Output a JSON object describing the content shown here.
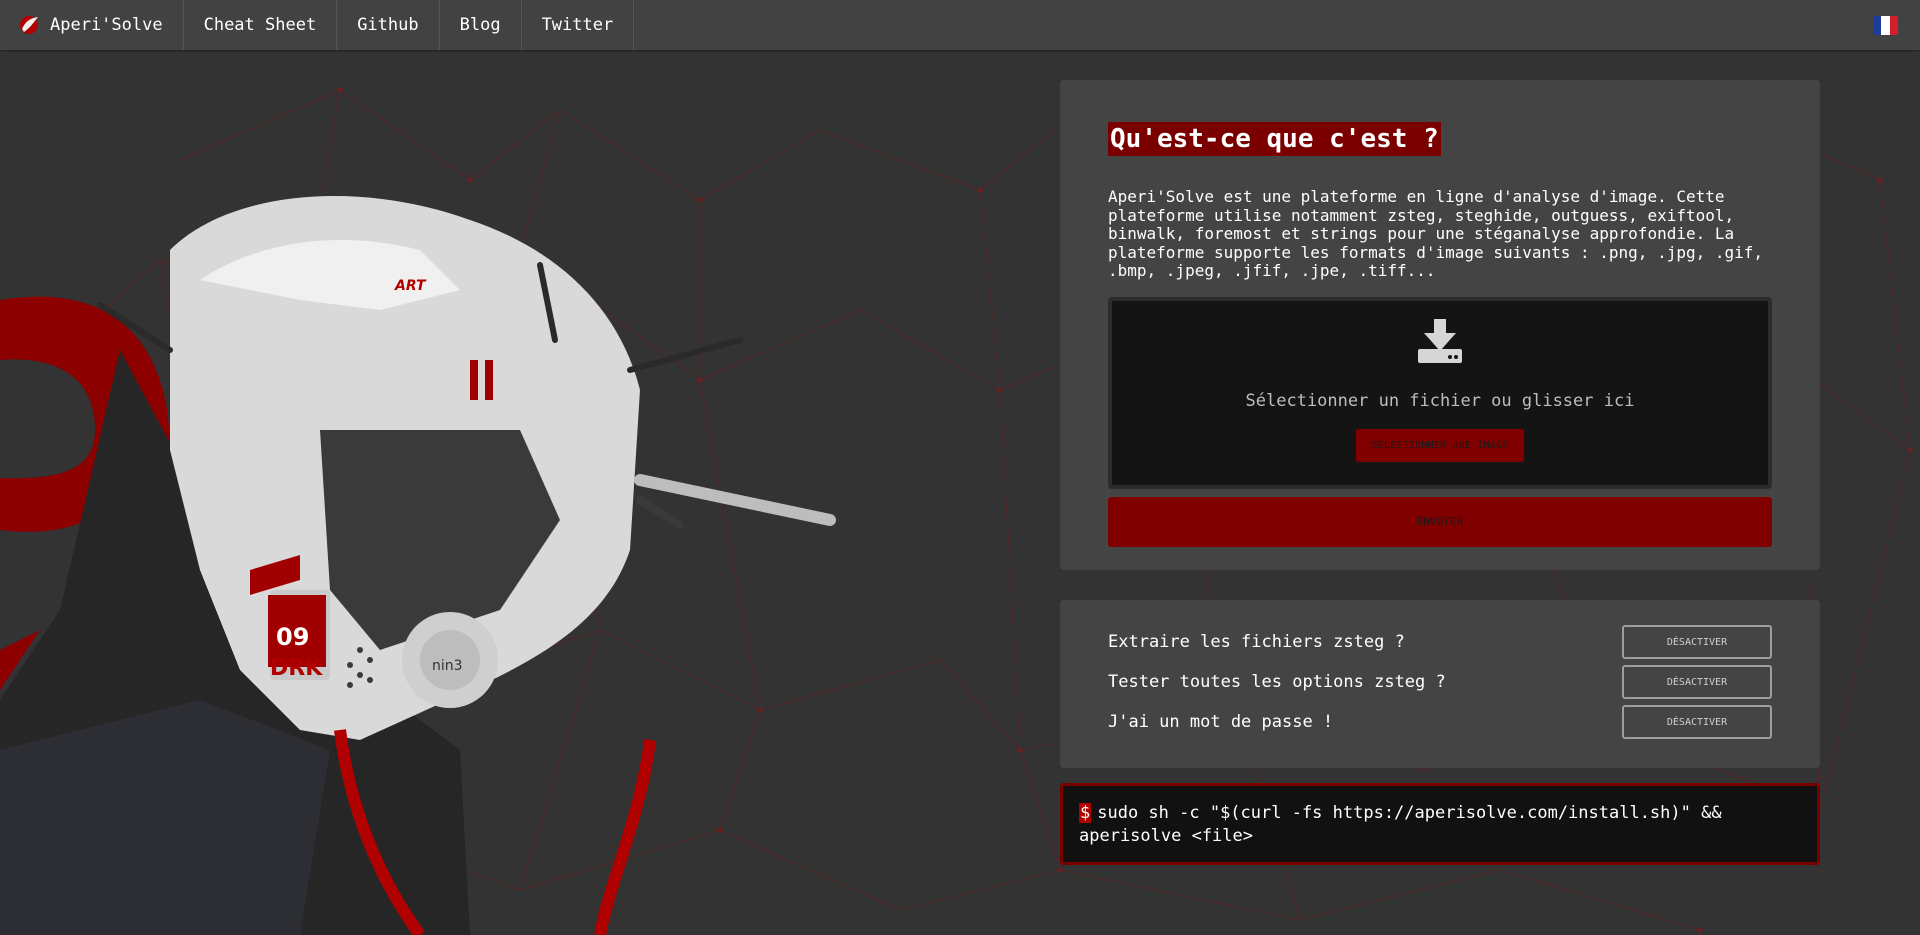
{
  "nav": {
    "brand": "Aperi'Solve",
    "links": [
      "Cheat Sheet",
      "Github",
      "Blog",
      "Twitter"
    ],
    "language_icon": "french-flag-icon"
  },
  "upload_card": {
    "title": "Qu'est-ce que c'est ?",
    "description": "Aperi'Solve est une plateforme en ligne d'analyse d'image. Cette plateforme utilise notamment zsteg, steghide, outguess, exiftool, binwalk, foremost et strings pour une stéganalyse approfondie. La plateforme supporte les formats d'image suivants : .png, .jpg, .gif, .bmp, .jpeg, .jfif, .jpe, .tiff...",
    "dropzone_icon": "download-icon",
    "dropzone_text": "Sélectionner un fichier ou glisser ici",
    "select_button": "SÉLECTIONNER UNE IMAGE",
    "submit_button": "ENVOYER"
  },
  "options": [
    {
      "label": "Extraire les fichiers zsteg ?",
      "button": "DÉSACTIVER"
    },
    {
      "label": "Tester toutes les options zsteg ?",
      "button": "DÉSACTIVER"
    },
    {
      "label": "J'ai un mot de passe !",
      "button": "DÉSACTIVER"
    }
  ],
  "terminal": {
    "prompt": "$",
    "command": "sudo sh -c \"$(curl -fs https://aperisolve.com/install.sh)\" && aperisolve <file>"
  },
  "hero": {
    "helmet_labels": [
      "ART",
      "09",
      "DRK",
      "nin3"
    ]
  },
  "colors": {
    "accent": "#800000",
    "background": "#333333",
    "card": "#444444",
    "navbar": "#424242"
  }
}
